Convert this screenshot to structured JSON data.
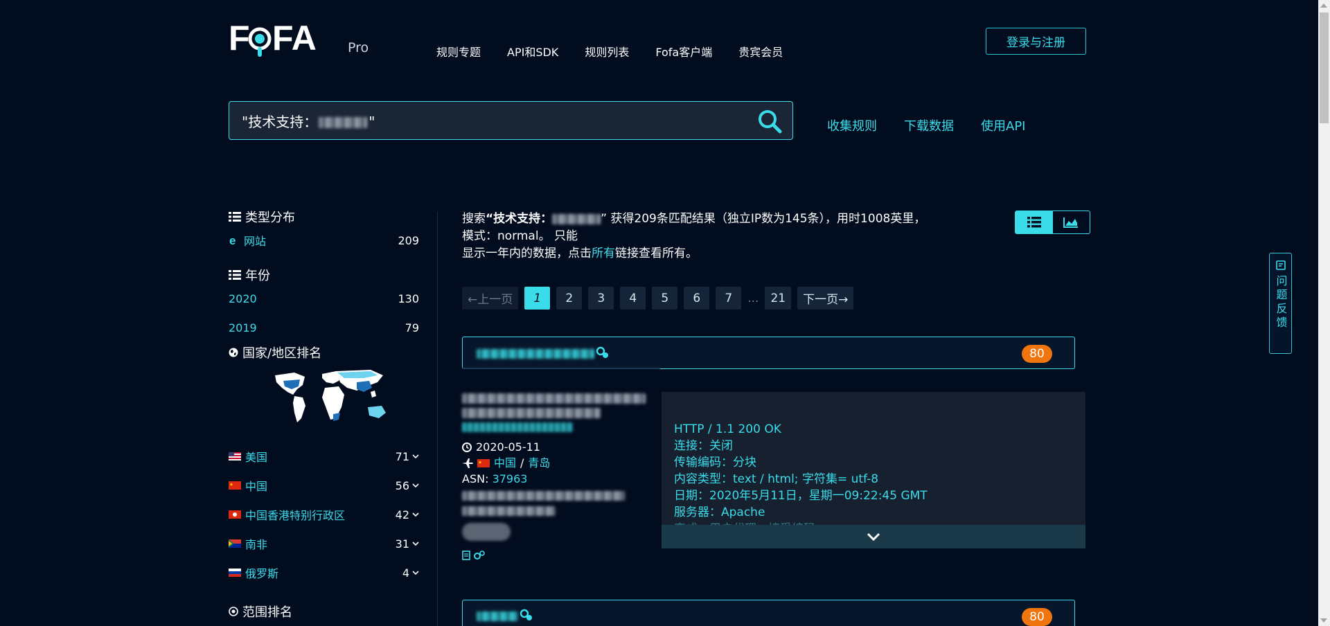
{
  "header": {
    "logo_text": "FOFA",
    "logo_badge": "Pro",
    "nav": [
      "规则专题",
      "API和SDK",
      "规则列表",
      "Fofa客户端",
      "贵宾会员"
    ],
    "login_label": "登录与注册"
  },
  "search": {
    "value": "\"技术支持：",
    "value_close": "\"",
    "links": [
      "收集规则",
      "下载数据",
      "使用API"
    ]
  },
  "sidebar": {
    "type_title": "类型分布",
    "type_items": [
      {
        "label": "网站",
        "count": "209"
      }
    ],
    "year_title": "年份",
    "year_items": [
      {
        "label": "2020",
        "count": "130"
      },
      {
        "label": "2019",
        "count": "79"
      }
    ],
    "country_title": "国家/地区排名",
    "country_items": [
      {
        "label": "美国",
        "count": "71"
      },
      {
        "label": "中国",
        "count": "56"
      },
      {
        "label": "中国香港特别行政区",
        "count": "42"
      },
      {
        "label": "南非",
        "count": "31"
      },
      {
        "label": "俄罗斯",
        "count": "4"
      }
    ],
    "range_title": "范围排名"
  },
  "summary": {
    "prefix": "搜索",
    "query": "“技术支持：",
    "result_text": "” 获得209条匹配结果（独立IP数为145条），用时1008英里，",
    "mode_text": "模式：normal。 只能",
    "notice_before": "显示一年内的数据，点击",
    "notice_link": "所有",
    "notice_after": "链接查看所有。"
  },
  "pagination": {
    "prev": "←上一页",
    "pages": [
      "1",
      "2",
      "3",
      "4",
      "5",
      "6",
      "7"
    ],
    "dots": "...",
    "last": "21",
    "next": "下一页→"
  },
  "result1": {
    "score": "80",
    "date": "2020-05-11",
    "country": "中国",
    "sep": "/",
    "city": "青岛",
    "asn_label": "ASN:",
    "asn": "37963",
    "http_lines": [
      "HTTP / 1.1 200 OK",
      "连接：关闭",
      "传输编码：分块",
      "内容类型：text / html; 字符集= utf-8",
      "日期：2020年5月11日，星期一09:22:45 GMT",
      "服务器：Apache"
    ],
    "http_faded": "变式：用户代理，接受编码"
  },
  "result2": {
    "score": "80"
  },
  "feedback_label": "问题反馈",
  "colors": {
    "accent": "#3bdcea",
    "background": "#020c1f",
    "score": "#f0750f"
  }
}
